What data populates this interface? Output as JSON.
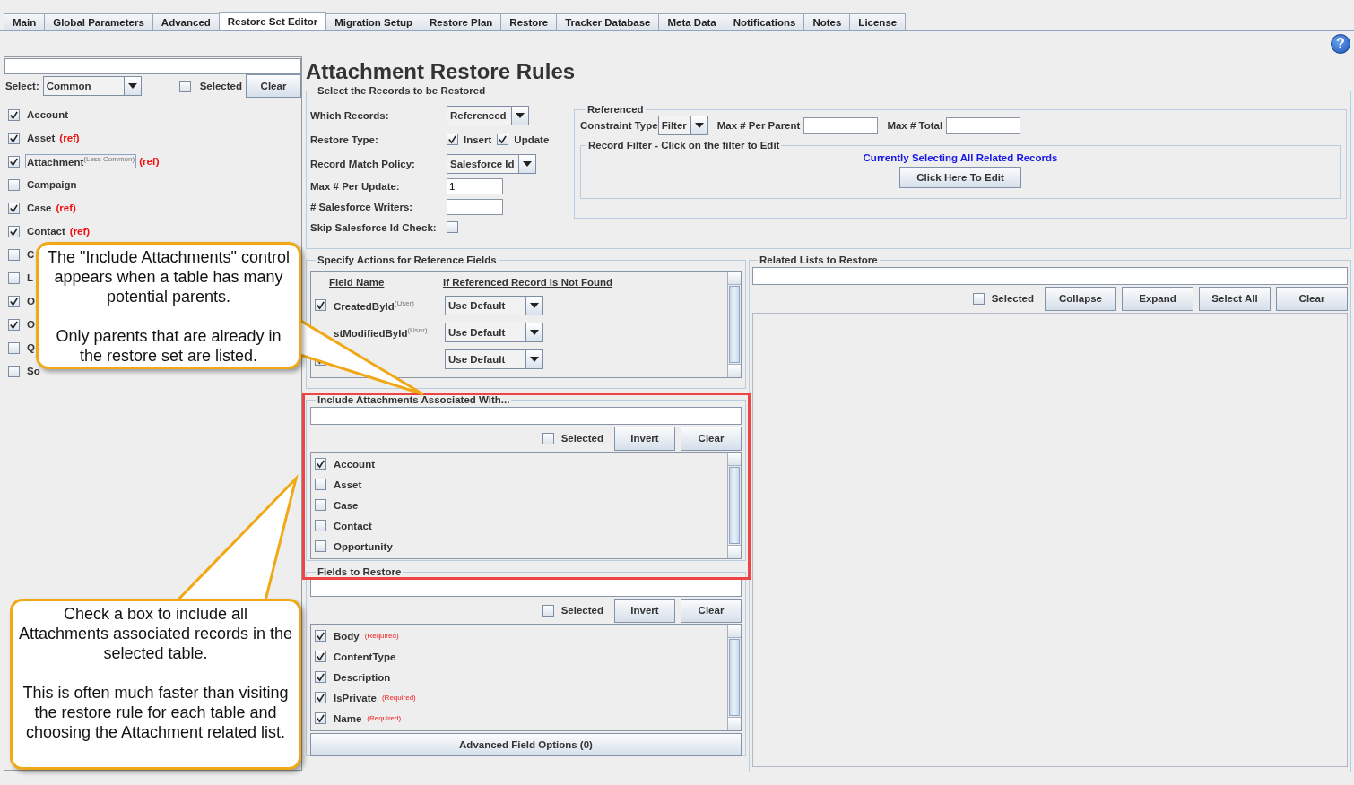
{
  "tabs": [
    {
      "label": "Main",
      "selected": false
    },
    {
      "label": "Global Parameters",
      "selected": false
    },
    {
      "label": "Advanced",
      "selected": false
    },
    {
      "label": "Restore Set Editor",
      "selected": true
    },
    {
      "label": "Migration Setup",
      "selected": false
    },
    {
      "label": "Restore Plan",
      "selected": false
    },
    {
      "label": "Restore",
      "selected": false
    },
    {
      "label": "Tracker Database",
      "selected": false
    },
    {
      "label": "Meta Data",
      "selected": false
    },
    {
      "label": "Notifications",
      "selected": false
    },
    {
      "label": "Notes",
      "selected": false
    },
    {
      "label": "License",
      "selected": false
    }
  ],
  "help_button": "?",
  "left_panel": {
    "select_label": "Select:",
    "select_value": "Common",
    "selected_label": "Selected",
    "selected_checked": false,
    "clear_button": "Clear",
    "items": [
      {
        "name": "Account",
        "checked": true,
        "focused": false
      },
      {
        "name": "Asset",
        "ref": "(ref)",
        "checked": true,
        "focused": false
      },
      {
        "name": "Attachment",
        "note": "(Less Common)",
        "ref": "(ref)",
        "checked": true,
        "focused": true
      },
      {
        "name": "Campaign",
        "checked": false,
        "focused": false
      },
      {
        "name": "Case",
        "ref": "(ref)",
        "checked": true,
        "focused": false
      },
      {
        "name": "Contact",
        "ref": "(ref)",
        "checked": true,
        "focused": false
      },
      {
        "name": "C",
        "checked": false,
        "focused": false
      },
      {
        "name": "L",
        "checked": false,
        "focused": false
      },
      {
        "name": "O",
        "checked": true,
        "focused": false
      },
      {
        "name": "O",
        "checked": true,
        "focused": false
      },
      {
        "name": "Q",
        "checked": false,
        "focused": false
      },
      {
        "name": "So",
        "checked": false,
        "focused": false
      }
    ]
  },
  "title": "Attachment Restore Rules",
  "records": {
    "legend": "Select the Records to be Restored",
    "which_records": {
      "label": "Which Records:",
      "value": "Referenced"
    },
    "restore_type": {
      "label": "Restore Type:",
      "options": [
        {
          "label": "Insert",
          "checked": true
        },
        {
          "label": "Update",
          "checked": true
        }
      ]
    },
    "match_policy": {
      "label": "Record Match Policy:",
      "value": "Salesforce Id"
    },
    "max_per_update": {
      "label": "Max # Per Update:",
      "value": "1"
    },
    "writers": {
      "label": "# Salesforce Writers:"
    },
    "skip_check": {
      "label": "Skip Salesforce Id Check:",
      "checked": false
    }
  },
  "referenced": {
    "legend": "Referenced",
    "constraint_label": "Constraint Type",
    "constraint_value": "Filter",
    "max_parent_label": "Max # Per Parent",
    "max_total_label": "Max # Total",
    "filter": {
      "legend": "Record Filter - Click on the filter to Edit",
      "status": "Currently  Selecting All Related Records",
      "button": "Click Here To Edit"
    }
  },
  "reference_fields": {
    "legend": "Specify Actions for Reference Fields",
    "columns": [
      "Field Name",
      "If Referenced Record is Not Found"
    ],
    "rows": [
      {
        "name": "CreatedById",
        "note": "(User)",
        "checked": true,
        "action": "Use Default"
      },
      {
        "name": "stModifiedById",
        "note": "(User)",
        "action": "Use Default"
      },
      {
        "checked": true,
        "action": "Use Default"
      }
    ]
  },
  "include_attachments": {
    "legend": "Include Attachments Associated With...",
    "selected_label": "Selected",
    "selected_checked": false,
    "buttons": [
      "Invert",
      "Clear"
    ],
    "items": [
      {
        "name": "Account",
        "checked": true
      },
      {
        "name": "Asset",
        "checked": false
      },
      {
        "name": "Case",
        "checked": false
      },
      {
        "name": "Contact",
        "checked": false
      },
      {
        "name": "Opportunity",
        "checked": false
      }
    ]
  },
  "fields_to_restore": {
    "legend": "Fields to Restore",
    "selected_label": "Selected",
    "selected_checked": false,
    "buttons": [
      "Invert",
      "Clear"
    ],
    "items": [
      {
        "name": "Body",
        "note": "(Required)",
        "checked": true
      },
      {
        "name": "ContentType",
        "checked": true
      },
      {
        "name": "Description",
        "checked": true
      },
      {
        "name": "IsPrivate",
        "note": "(Required)",
        "checked": true
      },
      {
        "name": "Name",
        "note": "(Required)",
        "checked": true
      }
    ],
    "advanced_button": "Advanced Field Options (0)"
  },
  "related_lists": {
    "legend": "Related Lists to Restore",
    "selected_label": "Selected",
    "selected_checked": false,
    "buttons": [
      "Collapse",
      "Expand",
      "Select All",
      "Clear"
    ]
  },
  "callouts": [
    {
      "paragraphs": [
        "The \"Include Attachments\" control appears when a table has many potential parents.",
        "Only parents that are already in the restore set are listed."
      ]
    },
    {
      "paragraphs": [
        "Check a box to include all Attachments associated records in the selected table.",
        "This is often much faster than visiting the restore rule for each table and choosing the Attachment related list."
      ]
    }
  ]
}
